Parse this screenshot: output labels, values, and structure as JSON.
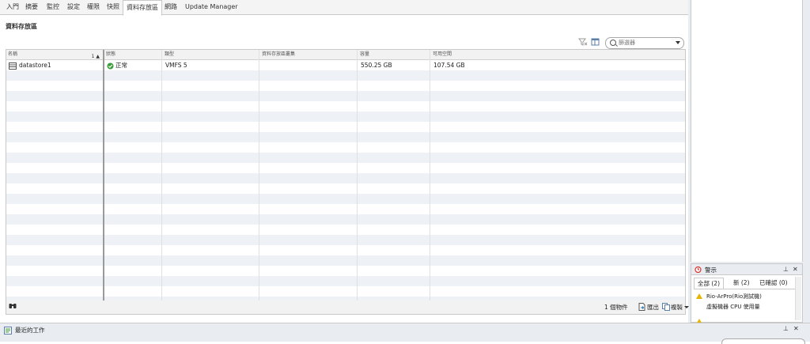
{
  "tabs": [
    {
      "label": "入門"
    },
    {
      "label": "摘要"
    },
    {
      "label": "監控"
    },
    {
      "label": "設定"
    },
    {
      "label": "權限"
    },
    {
      "label": "快照"
    },
    {
      "label": "資料存放區",
      "active": true
    },
    {
      "label": "網路"
    },
    {
      "label": "Update Manager"
    }
  ],
  "page_title": "資料存放區",
  "filter": {
    "placeholder": "篩選器"
  },
  "table": {
    "headers": [
      "名稱",
      "狀態",
      "類型",
      "資料存放區叢集",
      "容量",
      "可用空間"
    ],
    "sort_indicator": "1 ▲",
    "rows": [
      {
        "name": "datastore1",
        "status": "正常",
        "type": "VMFS 5",
        "cluster": "",
        "capacity": "550.25  GB",
        "free": "107.54  GB"
      }
    ]
  },
  "footer": {
    "count": "1 個物件",
    "export_label": "匯出",
    "copy_label": "複製"
  },
  "alarm_panel": {
    "title": "警示",
    "tabs": [
      "全部 (2)",
      "新 (2)",
      "已確認 (0)"
    ],
    "items": [
      {
        "line1": "Rio-ArPro(Rio測試機)",
        "line2": "虛擬機器 CPU 使用量"
      }
    ]
  },
  "recent_tasks": {
    "title": "最近的工作"
  },
  "colors": {
    "accent": "#1f6fb2",
    "ok": "#3a9d3a",
    "warning": "#e8b400"
  }
}
